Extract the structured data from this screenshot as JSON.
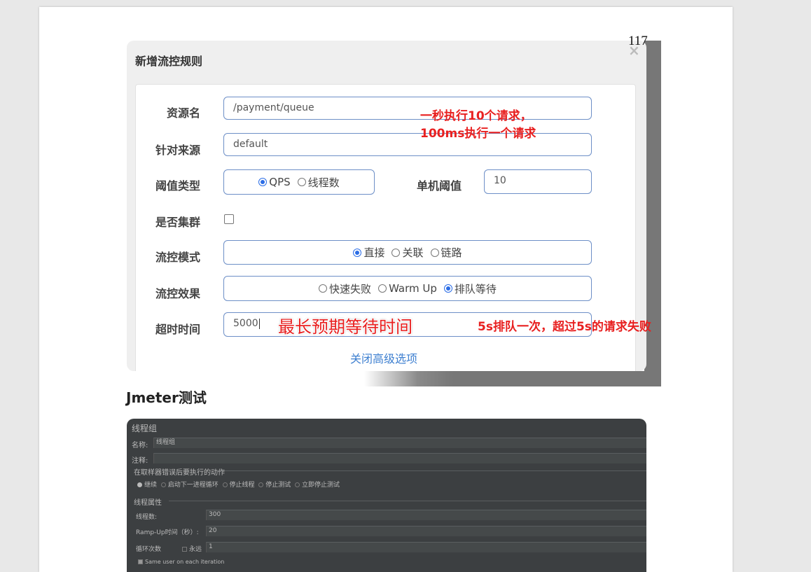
{
  "page_number": "117",
  "dialog": {
    "title": "新增流控规则",
    "close_glyph": "×",
    "resource": {
      "label": "资源名",
      "value": "/payment/queue"
    },
    "limit_app": {
      "label": "针对来源",
      "value": "default"
    },
    "grade": {
      "label": "阈值类型",
      "options": [
        "QPS",
        "线程数"
      ],
      "selected": "QPS"
    },
    "count": {
      "label": "单机阈值",
      "value": "10"
    },
    "cluster": {
      "label": "是否集群",
      "checked": false
    },
    "strategy": {
      "label": "流控模式",
      "options": [
        "直接",
        "关联",
        "链路"
      ],
      "selected": "直接"
    },
    "control_behavior": {
      "label": "流控效果",
      "options": [
        "快速失败",
        "Warm Up",
        "排队等待"
      ],
      "selected": "排队等待"
    },
    "timeout": {
      "label": "超时时间",
      "value": "5000"
    },
    "advanced_link": "关闭高级选项"
  },
  "annotations": {
    "rate_line1": "一秒执行10个请求，",
    "rate_line2": "100ms执行一个请求",
    "max_wait": "最长预期等待时间",
    "queue_note": "5s排队一次，超过5s的请求失败"
  },
  "section_heading": "Jmeter测试",
  "jmeter": {
    "panel_title": "线程组",
    "name_label": "名称:",
    "name_value": "线程组",
    "comment_label": "注释:",
    "comment_value": "",
    "error_action_title": "在取样器错误后要执行的动作",
    "error_actions": [
      "继续",
      "启动下一进程循环",
      "停止线程",
      "停止测试",
      "立即停止测试"
    ],
    "error_action_selected": "继续",
    "thread_props_title": "线程属性",
    "threads_label": "线程数:",
    "threads_value": "300",
    "rampup_label": "Ramp-Up时间（秒）:",
    "rampup_value": "20",
    "loop_label": "循环次数",
    "forever_label": "永远",
    "forever_checked": false,
    "loop_value": "1",
    "same_user_label": "Same user on each iteration",
    "same_user_checked": true
  },
  "colors": {
    "annotation_red": "#e82020",
    "field_border": "#6d8fc7",
    "radio_selected": "#2b6de6",
    "link_blue": "#3d7fd0",
    "jmeter_bg": "#3c3f41"
  }
}
